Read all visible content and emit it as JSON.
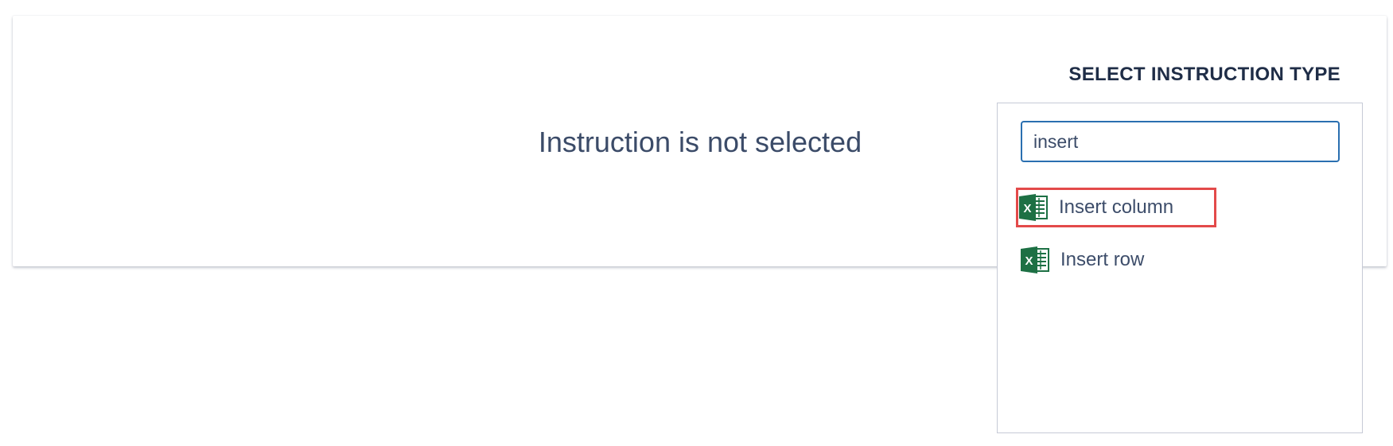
{
  "main": {
    "empty_message": "Instruction is not selected"
  },
  "instruction_picker": {
    "title": "SELECT INSTRUCTION TYPE",
    "search": {
      "value": "insert",
      "placeholder": ""
    },
    "options": [
      {
        "label": "Insert column",
        "icon": "excel-icon",
        "highlighted": true
      },
      {
        "label": "Insert row",
        "icon": "excel-icon",
        "highlighted": false
      }
    ]
  },
  "colors": {
    "accent_border": "#2a6fb0",
    "highlight_outline": "#e34a4a",
    "excel_green": "#1d7044"
  }
}
